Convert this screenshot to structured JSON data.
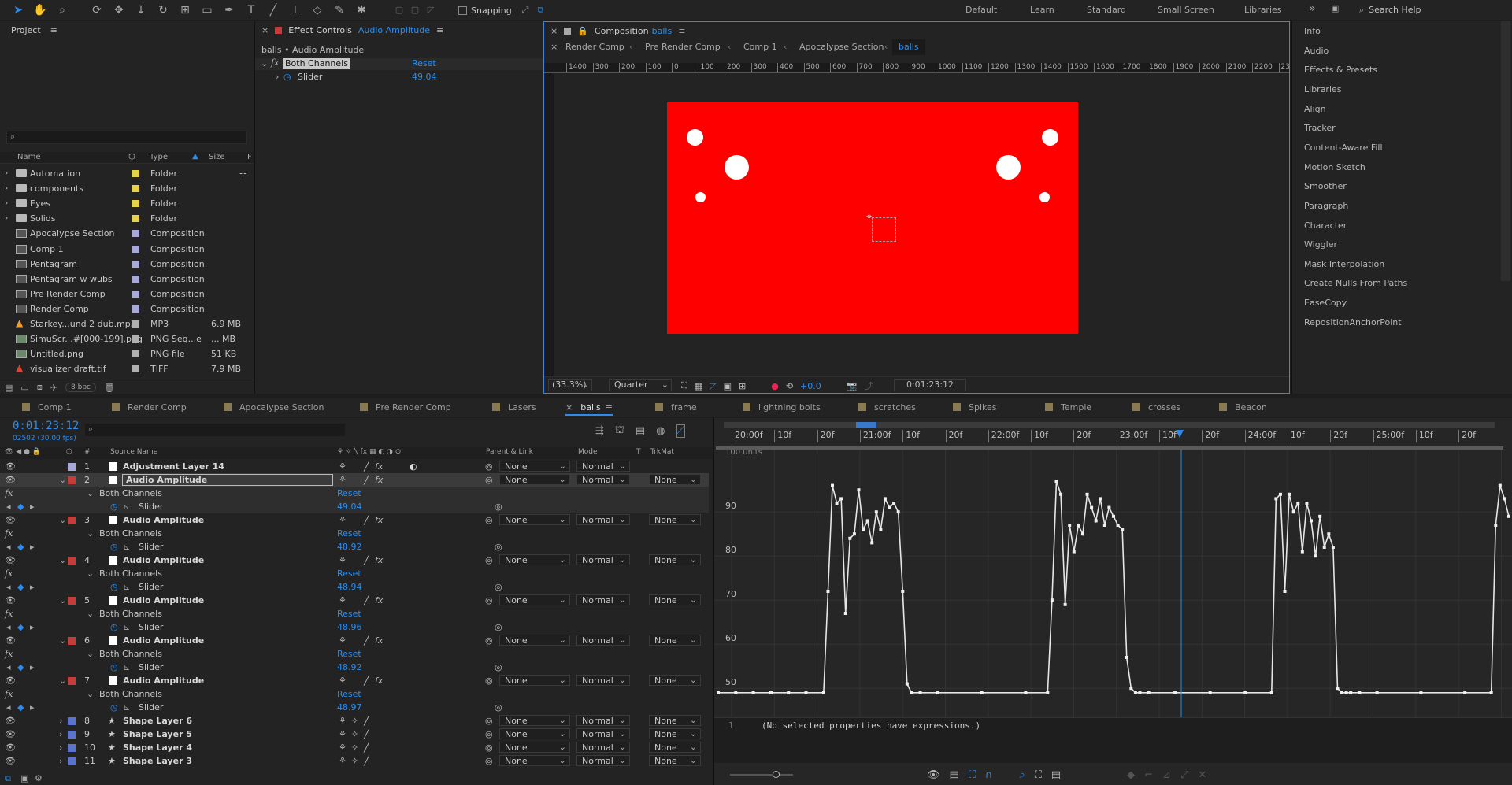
{
  "toolbar": {
    "snapping_label": "Snapping",
    "workspaces": [
      "Default",
      "Learn",
      "Standard",
      "Small Screen",
      "Libraries"
    ],
    "more_label": "»",
    "search_placeholder": "Search Help"
  },
  "project": {
    "title": "Project",
    "columns": {
      "name": "Name",
      "type": "Type",
      "size": "Size",
      "extra": "F"
    },
    "items": [
      {
        "name": "Automation",
        "type": "Folder",
        "size": "",
        "kind": "folder"
      },
      {
        "name": "components",
        "type": "Folder",
        "size": "",
        "kind": "folder"
      },
      {
        "name": "Eyes",
        "type": "Folder",
        "size": "",
        "kind": "folder"
      },
      {
        "name": "Solids",
        "type": "Folder",
        "size": "",
        "kind": "folder"
      },
      {
        "name": "Apocalypse Section",
        "type": "Composition",
        "size": "",
        "kind": "comp"
      },
      {
        "name": "Comp 1",
        "type": "Composition",
        "size": "",
        "kind": "comp"
      },
      {
        "name": "Pentagram",
        "type": "Composition",
        "size": "",
        "kind": "comp"
      },
      {
        "name": "Pentagram w wubs",
        "type": "Composition",
        "size": "",
        "kind": "comp"
      },
      {
        "name": "Pre Render Comp",
        "type": "Composition",
        "size": "",
        "kind": "comp"
      },
      {
        "name": "Render Comp",
        "type": "Composition",
        "size": "",
        "kind": "comp"
      },
      {
        "name": "Starkey...und 2 dub.mp3",
        "type": "MP3",
        "size": "6.9 MB",
        "kind": "audio"
      },
      {
        "name": "SimuScr...#[000-199].png",
        "type": "PNG Seq...e",
        "size": "... MB",
        "kind": "img"
      },
      {
        "name": "Untitled.png",
        "type": "PNG file",
        "size": "51 KB",
        "kind": "img"
      },
      {
        "name": "visualizer draft.tif",
        "type": "TIFF",
        "size": "7.9 MB",
        "kind": "tif"
      }
    ],
    "bpc_label": "8 bpc"
  },
  "effect_controls": {
    "title_prefix": "Effect Controls",
    "title_layer": "Audio Amplitude",
    "path": "balls • Audio Amplitude",
    "effect_name": "Both Channels",
    "reset_label": "Reset",
    "slider_label": "Slider",
    "slider_value": "49.04"
  },
  "composition": {
    "title_prefix": "Composition",
    "title_comp": "balls",
    "breadcrumbs": [
      "Render Comp",
      "Pre Render Comp",
      "Comp 1",
      "Apocalypse Section",
      "balls"
    ],
    "ruler_labels": [
      "1400",
      "300",
      "200",
      "100",
      "0",
      "100",
      "200",
      "300",
      "400",
      "500",
      "600",
      "700",
      "800",
      "900",
      "1000",
      "1100",
      "1200",
      "1300",
      "1400",
      "1500",
      "1600",
      "1700",
      "1800",
      "1900",
      "2000",
      "2100",
      "2200",
      "2300"
    ],
    "zoom": "(33.3%)",
    "resolution": "Quarter",
    "exposure": "+0.0",
    "timecode": "0:01:23:12",
    "bg_color": "#ff0000"
  },
  "right_panel": {
    "items": [
      "Info",
      "Audio",
      "Effects & Presets",
      "Libraries",
      "Align",
      "Tracker",
      "Content-Aware Fill",
      "Motion Sketch",
      "Smoother",
      "Paragraph",
      "Character",
      "Wiggler",
      "Mask Interpolation",
      "Create Nulls From Paths",
      "EaseCopy",
      "RepositionAnchorPoint"
    ]
  },
  "timeline_tabs": [
    "Comp 1",
    "Render Comp",
    "Apocalypse Section",
    "Pre Render Comp",
    "Lasers",
    "balls",
    "frame",
    "lightning bolts",
    "scratches",
    "Spikes",
    "Temple",
    "crosses",
    "Beacon"
  ],
  "timeline": {
    "timecode": "0:01:23:12",
    "frame_info": "02502 (30.00 fps)",
    "col_source": "Source Name",
    "col_parent": "Parent & Link",
    "col_mode": "Mode",
    "col_t": "T",
    "col_trkmat": "TrkMat",
    "layers": [
      {
        "num": "1",
        "name": "Adjustment Layer 14",
        "label": "#a9a9d9",
        "parent": "None",
        "mode": "Normal",
        "trkmat": "",
        "kind": "adj"
      },
      {
        "num": "2",
        "name": "Audio Amplitude",
        "label": "#c83b3b",
        "parent": "None",
        "mode": "Normal",
        "trkmat": "None",
        "kind": "audio",
        "effect": "Both Channels",
        "reset": "Reset",
        "slider": "Slider",
        "value": "49.04"
      },
      {
        "num": "3",
        "name": "Audio Amplitude",
        "label": "#c83b3b",
        "parent": "None",
        "mode": "Normal",
        "trkmat": "None",
        "kind": "audio",
        "effect": "Both Channels",
        "reset": "Reset",
        "slider": "Slider",
        "value": "48.92"
      },
      {
        "num": "4",
        "name": "Audio Amplitude",
        "label": "#c83b3b",
        "parent": "None",
        "mode": "Normal",
        "trkmat": "None",
        "kind": "audio",
        "effect": "Both Channels",
        "reset": "Reset",
        "slider": "Slider",
        "value": "48.94"
      },
      {
        "num": "5",
        "name": "Audio Amplitude",
        "label": "#c83b3b",
        "parent": "None",
        "mode": "Normal",
        "trkmat": "None",
        "kind": "audio",
        "effect": "Both Channels",
        "reset": "Reset",
        "slider": "Slider",
        "value": "48.96"
      },
      {
        "num": "6",
        "name": "Audio Amplitude",
        "label": "#c83b3b",
        "parent": "None",
        "mode": "Normal",
        "trkmat": "None",
        "kind": "audio",
        "effect": "Both Channels",
        "reset": "Reset",
        "slider": "Slider",
        "value": "48.92"
      },
      {
        "num": "7",
        "name": "Audio Amplitude",
        "label": "#c83b3b",
        "parent": "None",
        "mode": "Normal",
        "trkmat": "None",
        "kind": "audio",
        "effect": "Both Channels",
        "reset": "Reset",
        "slider": "Slider",
        "value": "48.97"
      },
      {
        "num": "8",
        "name": "Shape Layer 6",
        "label": "#5a73d0",
        "parent": "None",
        "mode": "Normal",
        "trkmat": "None",
        "kind": "shape"
      },
      {
        "num": "9",
        "name": "Shape Layer 5",
        "label": "#5a73d0",
        "parent": "None",
        "mode": "Normal",
        "trkmat": "None",
        "kind": "shape"
      },
      {
        "num": "10",
        "name": "Shape Layer 4",
        "label": "#5a73d0",
        "parent": "None",
        "mode": "Normal",
        "trkmat": "None",
        "kind": "shape"
      },
      {
        "num": "11",
        "name": "Shape Layer 3",
        "label": "#5a73d0",
        "parent": "None",
        "mode": "Normal",
        "trkmat": "None",
        "kind": "shape"
      }
    ]
  },
  "graph": {
    "time_labels": [
      "20:00f",
      "10f",
      "20f",
      "21:00f",
      "10f",
      "20f",
      "22:00f",
      "10f",
      "20f",
      "23:00f",
      "10f",
      "20f",
      "24:00f",
      "10f",
      "20f",
      "25:00f",
      "10f",
      "20f"
    ],
    "unit_label": "100 units",
    "y_labels": [
      "90",
      "80",
      "70",
      "60",
      "50"
    ],
    "expression_text": "(No selected properties have expressions.)",
    "expression_line": "1"
  },
  "chart_data": {
    "type": "line",
    "title": "",
    "ylabel": "",
    "xlabel": "",
    "ylim": [
      47,
      102
    ],
    "y_ticks": [
      50,
      60,
      70,
      80,
      90
    ],
    "x": [
      0,
      4,
      8,
      12,
      16,
      20,
      24,
      25,
      26,
      27,
      28,
      29,
      30,
      31,
      32,
      33,
      34,
      35,
      36,
      37,
      38,
      39,
      40,
      41,
      42,
      43,
      44,
      46,
      50,
      60,
      70,
      75,
      76,
      77,
      78,
      79,
      80,
      81,
      82,
      83,
      84,
      85,
      86,
      87,
      88,
      89,
      90,
      91,
      92,
      93,
      94,
      95,
      96,
      98,
      104,
      112,
      120,
      126,
      127,
      128,
      129,
      130,
      131,
      132,
      133,
      134,
      135,
      136,
      137,
      138,
      139,
      140,
      141,
      142,
      143,
      144,
      146,
      150,
      160,
      170,
      176,
      177,
      178,
      179,
      180
    ],
    "series": [
      {
        "values": [
          49,
          49,
          49,
          49,
          49,
          49,
          49,
          72,
          96,
          92,
          93,
          67,
          84,
          85,
          95,
          86,
          88,
          83,
          90,
          86,
          93,
          91,
          92,
          90,
          72,
          51,
          49,
          49,
          49,
          49,
          49,
          49,
          70,
          97,
          94,
          69,
          87,
          81,
          87,
          85,
          94,
          91,
          88,
          93,
          87,
          91,
          89,
          87,
          86,
          57,
          50,
          49,
          49,
          49,
          49,
          49,
          49,
          49,
          93,
          94,
          72,
          94,
          90,
          92,
          81,
          92,
          88,
          80,
          89,
          82,
          85,
          82,
          50,
          49,
          49,
          49,
          49,
          49,
          49,
          49,
          49,
          87,
          96,
          93,
          89,
          93
        ]
      }
    ]
  }
}
